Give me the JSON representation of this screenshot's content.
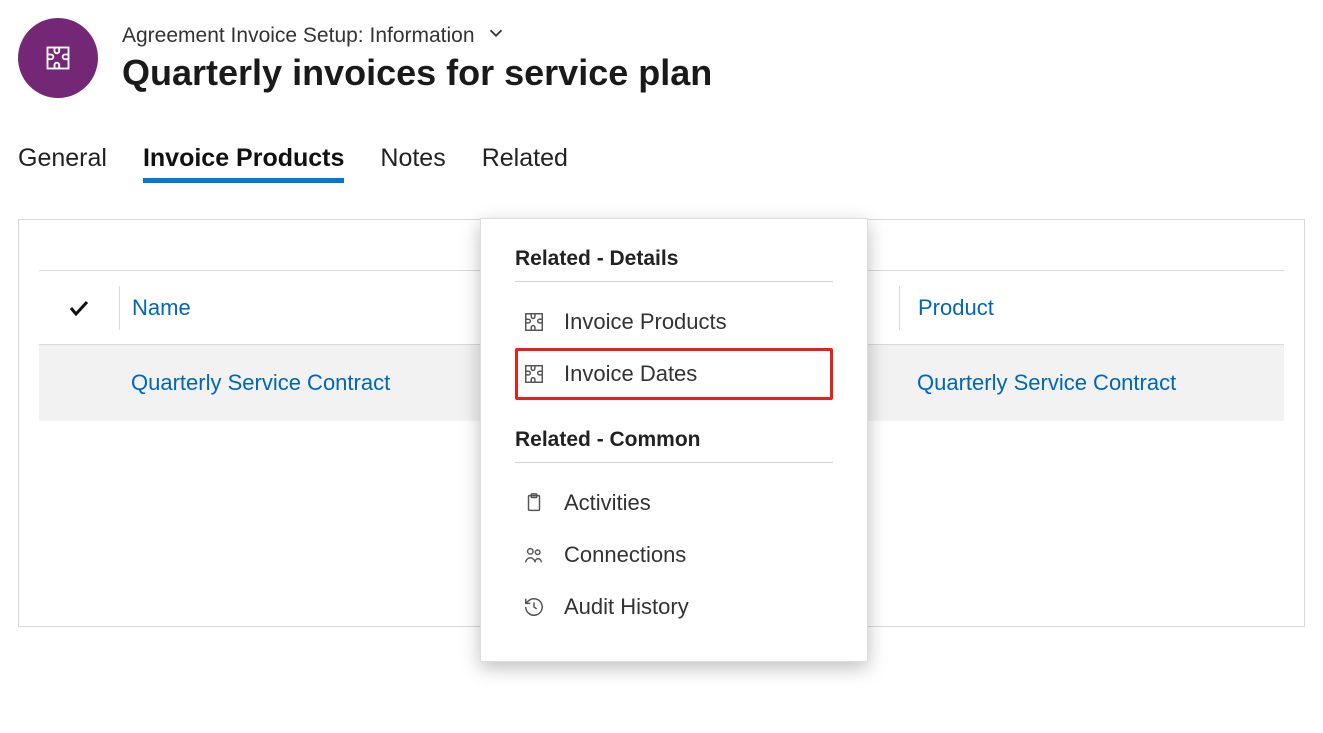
{
  "header": {
    "form_label": "Agreement Invoice Setup: Information",
    "title": "Quarterly invoices for service plan"
  },
  "tabs": {
    "general": "General",
    "invoice_products": "Invoice Products",
    "notes": "Notes",
    "related": "Related"
  },
  "grid": {
    "columns": {
      "name": "Name",
      "product": "Product"
    },
    "rows": [
      {
        "name": "Quarterly Service Contract",
        "product": "Quarterly Service Contract"
      }
    ]
  },
  "dropdown": {
    "section_details": "Related - Details",
    "section_common": "Related - Common",
    "items_details": [
      {
        "label": "Invoice Products",
        "icon": "puzzle-icon"
      },
      {
        "label": "Invoice Dates",
        "icon": "puzzle-icon",
        "highlight": true
      }
    ],
    "items_common": [
      {
        "label": "Activities",
        "icon": "clipboard-icon"
      },
      {
        "label": "Connections",
        "icon": "people-icon"
      },
      {
        "label": "Audit History",
        "icon": "history-icon"
      }
    ]
  }
}
